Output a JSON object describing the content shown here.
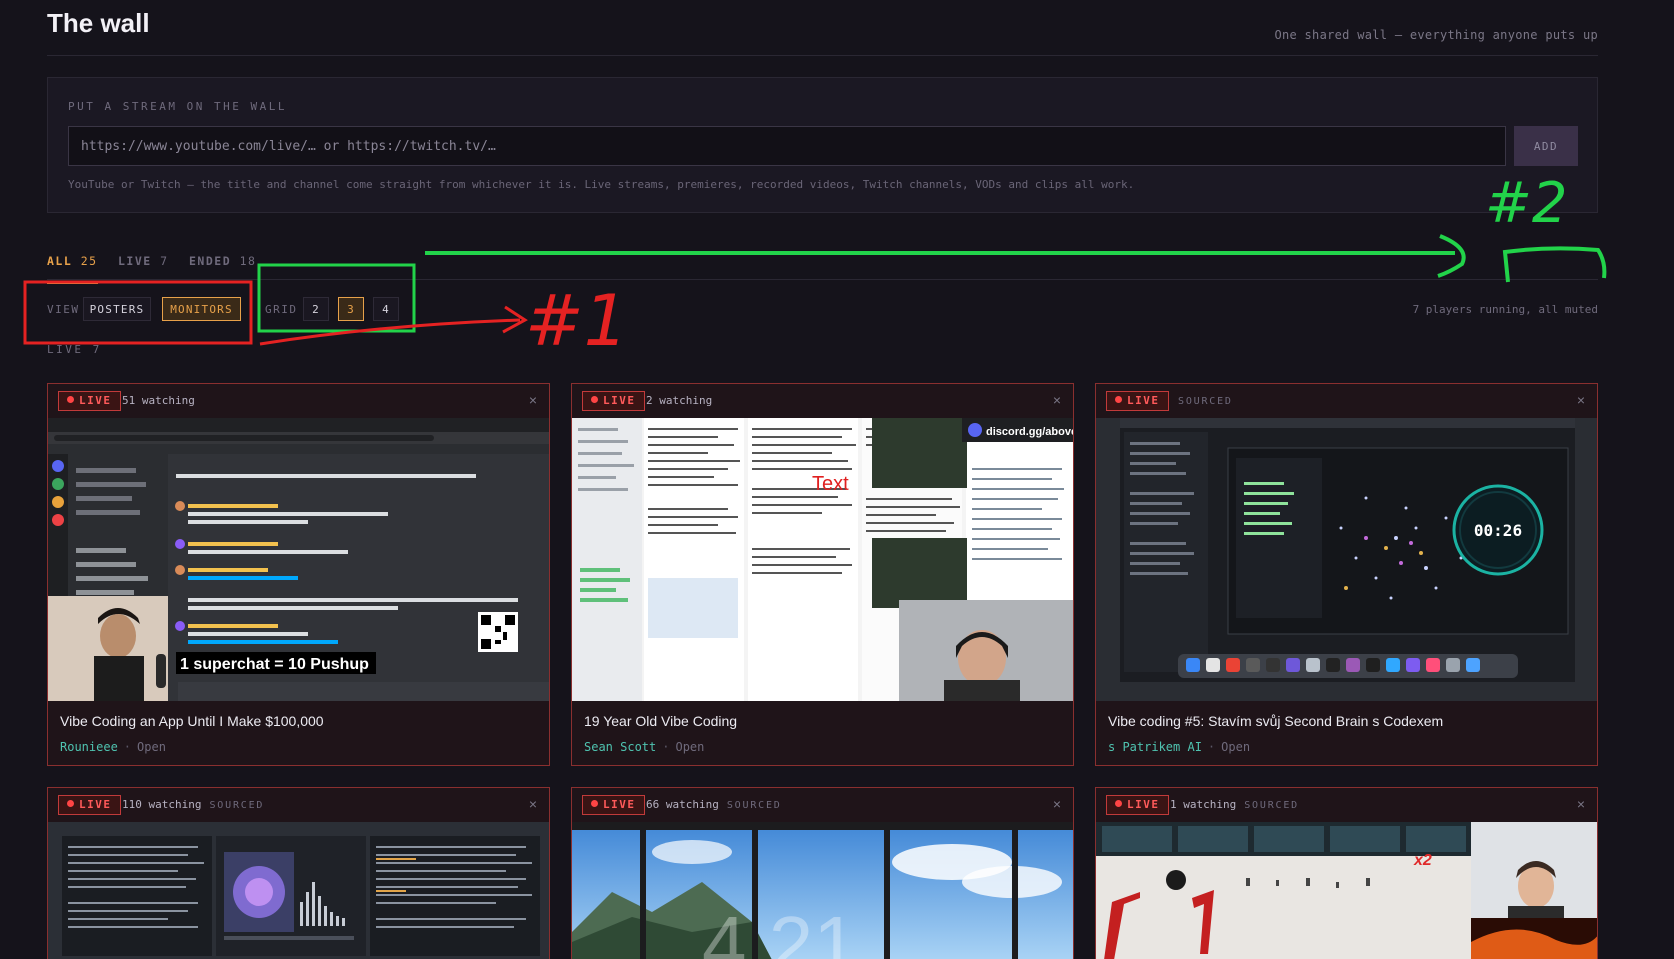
{
  "header": {
    "title": "The wall",
    "tagline": "One shared wall — everything anyone puts up"
  },
  "add_panel": {
    "label": "PUT A STREAM ON THE WALL",
    "input_placeholder": "https://www.youtube.com/live/… or https://twitch.tv/…",
    "input_value": "",
    "add_label": "ADD",
    "help": "YouTube or Twitch — the title and channel come straight from whichever it is. Live streams, premieres, recorded videos, Twitch channels, VODs and clips all work."
  },
  "tabs": [
    {
      "name": "ALL",
      "count": "25",
      "active": true
    },
    {
      "name": "LIVE",
      "count": "7",
      "active": false
    },
    {
      "name": "ENDED",
      "count": "18",
      "active": false
    }
  ],
  "view": {
    "label": "VIEW",
    "options": [
      "POSTERS",
      "MONITORS"
    ],
    "selected": "MONITORS"
  },
  "grid": {
    "label": "GRID",
    "options": [
      "2",
      "3",
      "4"
    ],
    "selected": "3"
  },
  "players_status": "7 players running, all muted",
  "section_label": "LIVE 7",
  "cards": [
    {
      "badge": "LIVE",
      "watching": "51 watching",
      "sourced": "",
      "close": "×",
      "title": "Vibe Coding an App Until I Make $100,000",
      "channel": "Rounieee",
      "open": "Open",
      "overlay": "1 superchat = 10 Pushup"
    },
    {
      "badge": "LIVE",
      "watching": "2 watching",
      "sourced": "",
      "close": "×",
      "title": "19 Year Old Vibe Coding",
      "channel": "Sean Scott",
      "open": "Open",
      "overlay": "discord.gg/above",
      "overlay2": "Text"
    },
    {
      "badge": "LIVE",
      "watching": "",
      "sourced": "SOURCED",
      "close": "×",
      "title": "Vibe coding #5: Stavím svůj Second Brain s Codexem",
      "channel": "s Patrikem AI",
      "open": "Open",
      "overlay": "00:26"
    },
    {
      "badge": "LIVE",
      "watching": "110 watching",
      "sourced": "SOURCED",
      "close": "×"
    },
    {
      "badge": "LIVE",
      "watching": "66 watching",
      "sourced": "SOURCED",
      "close": "×",
      "overlay": "4.21"
    },
    {
      "badge": "LIVE",
      "watching": "1 watching",
      "sourced": "SOURCED",
      "close": "×",
      "overlay": "x2"
    }
  ],
  "annotations": {
    "label1": "#1",
    "label2": "#2",
    "color_box": "#22d34a",
    "color_arrow": "#e52222"
  },
  "colors": {
    "background": "#15131b",
    "accent": "#e7a14a",
    "live": "#ff4545",
    "channel": "#4fc3b0"
  }
}
